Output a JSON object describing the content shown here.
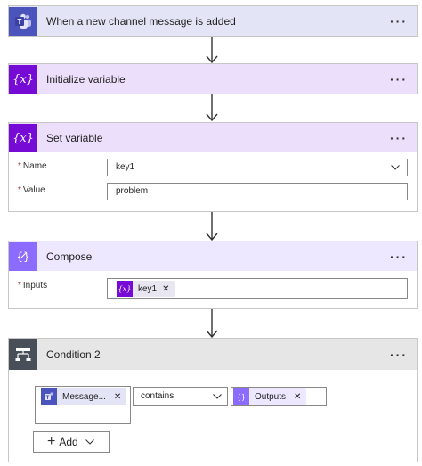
{
  "colors": {
    "teams": "#4b53bc",
    "variable": "#770bd6",
    "variable_header": "#ecdffb",
    "compose": "#8c6cff",
    "compose_header": "#ede8ff",
    "condition": "#484f58",
    "condition_header": "#e6e6e6",
    "trigger_header": "#e3e4f5"
  },
  "trigger": {
    "title": "When a new channel message is added",
    "more": "···",
    "icon": "teams-icon"
  },
  "init_variable": {
    "title": "Initialize variable",
    "more": "···",
    "icon": "variable-icon"
  },
  "set_variable": {
    "title": "Set variable",
    "more": "···",
    "icon": "variable-icon",
    "name_label": "Name",
    "name_value": "key1",
    "value_label": "Value",
    "value_value": "problem",
    "required_mark": "*"
  },
  "compose": {
    "title": "Compose",
    "more": "···",
    "icon": "compose-icon",
    "inputs_label": "Inputs",
    "inputs_token": "key1",
    "required_mark": "*"
  },
  "condition": {
    "title": "Condition 2",
    "more": "···",
    "icon": "condition-icon",
    "left_token": "Message...",
    "operator": "contains",
    "right_token": "Outputs",
    "add_label": "Add"
  }
}
